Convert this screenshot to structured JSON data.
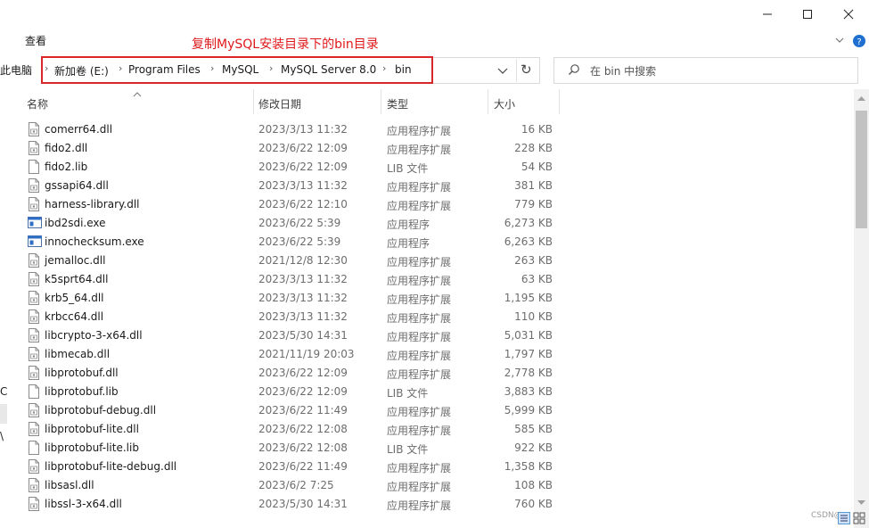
{
  "ribbon": {
    "view_tab": "查看"
  },
  "annotation": "复制MySQL安装目录下的bin目录",
  "address": {
    "left_label": "此电脑",
    "crumbs": [
      "新加卷 (E:)",
      "Program Files",
      "MySQL",
      "MySQL Server 8.0",
      "bin"
    ],
    "separator": "›",
    "dropdown": "⌄",
    "refresh": "↻"
  },
  "search": {
    "placeholder": "在 bin 中搜索"
  },
  "columns": {
    "name": "名称",
    "date": "修改日期",
    "type": "类型",
    "size": "大小"
  },
  "files": [
    {
      "name": "comerr64.dll",
      "date": "2023/3/13 11:32",
      "type": "应用程序扩展",
      "size": "16 KB",
      "icon": "dll"
    },
    {
      "name": "fido2.dll",
      "date": "2023/6/22 12:09",
      "type": "应用程序扩展",
      "size": "228 KB",
      "icon": "dll"
    },
    {
      "name": "fido2.lib",
      "date": "2023/6/22 12:09",
      "type": "LIB 文件",
      "size": "54 KB",
      "icon": "file"
    },
    {
      "name": "gssapi64.dll",
      "date": "2023/3/13 11:32",
      "type": "应用程序扩展",
      "size": "381 KB",
      "icon": "dll"
    },
    {
      "name": "harness-library.dll",
      "date": "2023/6/22 12:10",
      "type": "应用程序扩展",
      "size": "779 KB",
      "icon": "dll"
    },
    {
      "name": "ibd2sdi.exe",
      "date": "2023/6/22 5:39",
      "type": "应用程序",
      "size": "6,273 KB",
      "icon": "exe"
    },
    {
      "name": "innochecksum.exe",
      "date": "2023/6/22 5:39",
      "type": "应用程序",
      "size": "6,263 KB",
      "icon": "exe"
    },
    {
      "name": "jemalloc.dll",
      "date": "2021/12/8 12:30",
      "type": "应用程序扩展",
      "size": "263 KB",
      "icon": "dll"
    },
    {
      "name": "k5sprt64.dll",
      "date": "2023/3/13 11:32",
      "type": "应用程序扩展",
      "size": "63 KB",
      "icon": "dll"
    },
    {
      "name": "krb5_64.dll",
      "date": "2023/3/13 11:32",
      "type": "应用程序扩展",
      "size": "1,195 KB",
      "icon": "dll"
    },
    {
      "name": "krbcc64.dll",
      "date": "2023/3/13 11:32",
      "type": "应用程序扩展",
      "size": "110 KB",
      "icon": "dll"
    },
    {
      "name": "libcrypto-3-x64.dll",
      "date": "2023/5/30 14:31",
      "type": "应用程序扩展",
      "size": "5,031 KB",
      "icon": "dll"
    },
    {
      "name": "libmecab.dll",
      "date": "2021/11/19 20:03",
      "type": "应用程序扩展",
      "size": "1,797 KB",
      "icon": "dll"
    },
    {
      "name": "libprotobuf.dll",
      "date": "2023/6/22 12:09",
      "type": "应用程序扩展",
      "size": "2,778 KB",
      "icon": "dll"
    },
    {
      "name": "libprotobuf.lib",
      "date": "2023/6/22 12:09",
      "type": "LIB 文件",
      "size": "3,883 KB",
      "icon": "file"
    },
    {
      "name": "libprotobuf-debug.dll",
      "date": "2023/6/22 11:49",
      "type": "应用程序扩展",
      "size": "5,999 KB",
      "icon": "dll"
    },
    {
      "name": "libprotobuf-lite.dll",
      "date": "2023/6/22 12:08",
      "type": "应用程序扩展",
      "size": "585 KB",
      "icon": "dll"
    },
    {
      "name": "libprotobuf-lite.lib",
      "date": "2023/6/22 12:08",
      "type": "LIB 文件",
      "size": "922 KB",
      "icon": "file"
    },
    {
      "name": "libprotobuf-lite-debug.dll",
      "date": "2023/6/22 11:49",
      "type": "应用程序扩展",
      "size": "1,358 KB",
      "icon": "dll"
    },
    {
      "name": "libsasl.dll",
      "date": "2023/6/2 7:25",
      "type": "应用程序扩展",
      "size": "108 KB",
      "icon": "dll"
    },
    {
      "name": "libssl-3-x64.dll",
      "date": "2023/5/30 14:31",
      "type": "应用程序扩展",
      "size": "760 KB",
      "icon": "dll"
    }
  ],
  "nav_stubs": [
    "C",
    "\\"
  ],
  "watermark": "CSDN@"
}
